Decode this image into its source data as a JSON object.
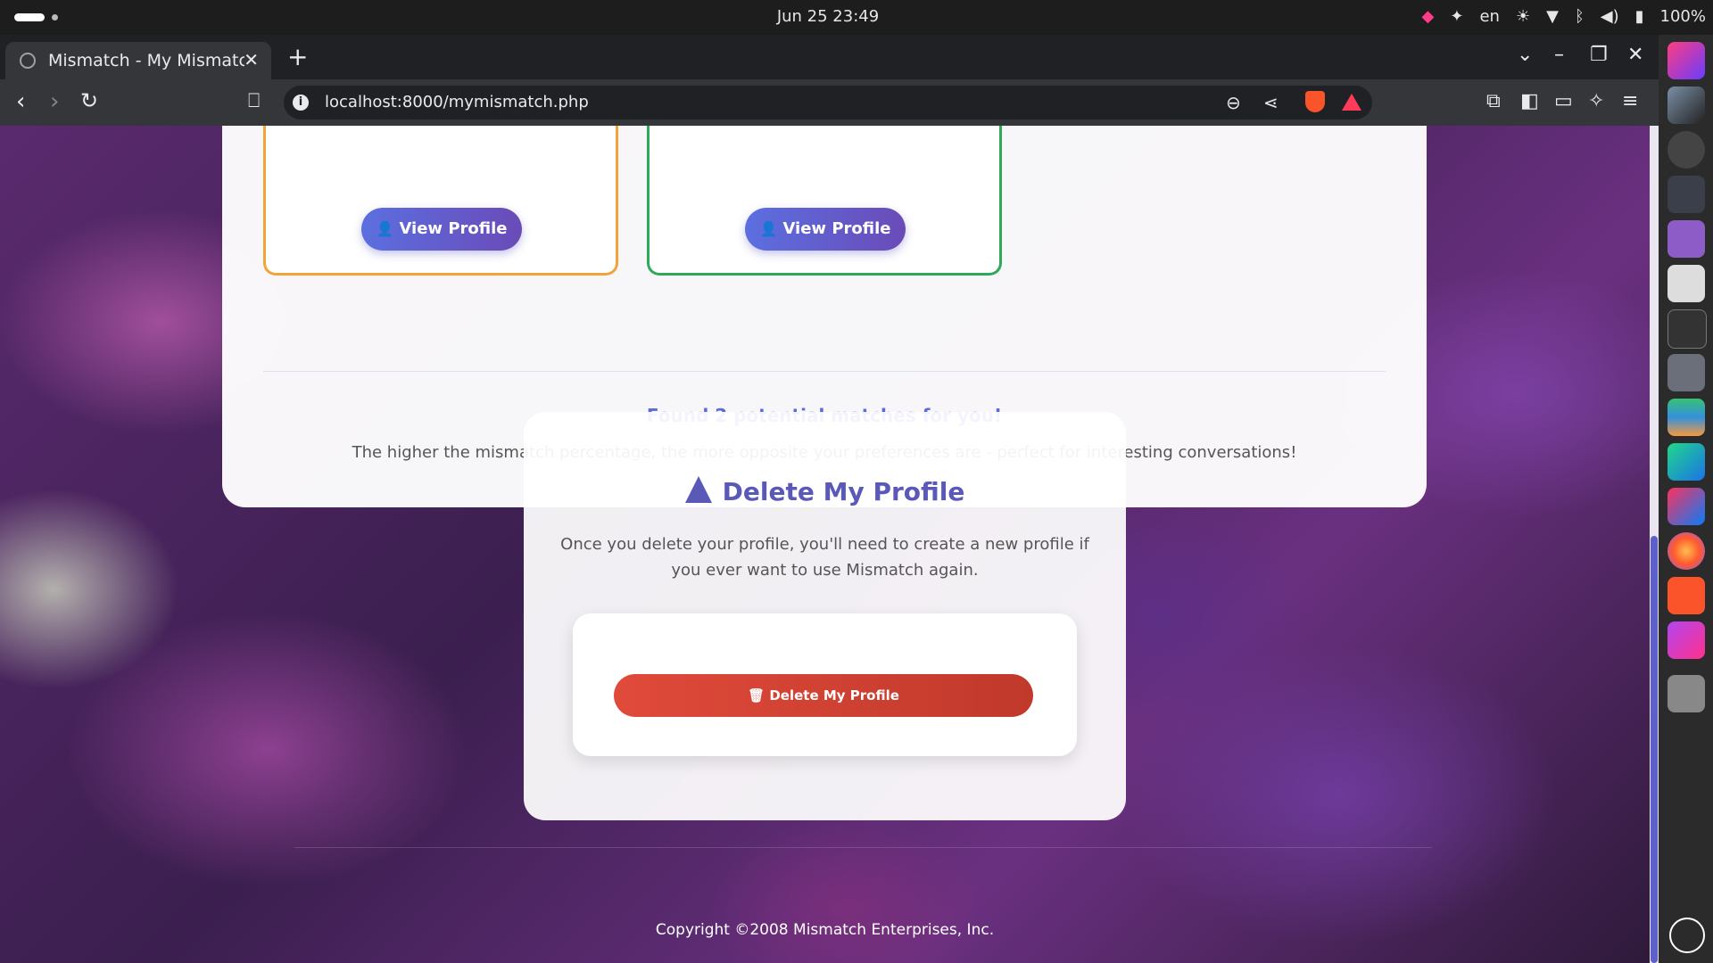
{
  "system": {
    "clock": "Jun 25  23:49",
    "lang": "en",
    "battery": "100%"
  },
  "browser": {
    "tab_title": "Mismatch - My Mismatch",
    "url": "localhost:8000/mymismatch.php"
  },
  "matches": {
    "view_profile_label": "View Profile",
    "found_text": "Found 2 potential matches for you!",
    "hint_text": "The higher the mismatch percentage, the more opposite your preferences are - perfect for interesting conversations!"
  },
  "delete": {
    "title": "Delete My Profile",
    "description": "Once you delete your profile, you'll need to create a new profile if you ever want to use Mismatch again.",
    "button_label": "Delete My Profile"
  },
  "footer": {
    "copyright": "Copyright ©2008 Mismatch Enterprises, Inc."
  },
  "colors": {
    "accent": "#5b6bd8",
    "danger": "#d9402f",
    "orange_border": "#f0a43a",
    "green_border": "#2fa85a"
  }
}
